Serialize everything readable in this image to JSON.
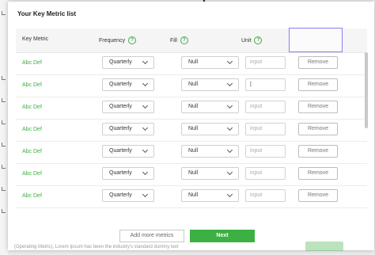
{
  "modal": {
    "title": "Your Key Metric list",
    "columns": {
      "metric": "Key Metric",
      "frequency": "Frequency",
      "fill": "Fill",
      "unit": "Unit",
      "help_glyph": "?"
    },
    "rows": [
      {
        "metric": "Abc Def",
        "frequency": "Quarterly",
        "fill": "Null",
        "unit_placeholder": "input",
        "unit_value": "",
        "remove": "Remove"
      },
      {
        "metric": "Abc Def",
        "frequency": "Quarterly",
        "fill": "Null",
        "unit_placeholder": "",
        "unit_value": "|",
        "remove": "Remove"
      },
      {
        "metric": "Abc Def",
        "frequency": "Quarterly",
        "fill": "Null",
        "unit_placeholder": "input",
        "unit_value": "",
        "remove": "Remove"
      },
      {
        "metric": "Abc Def",
        "frequency": "Quarterly",
        "fill": "Null",
        "unit_placeholder": "input",
        "unit_value": "",
        "remove": "Remove"
      },
      {
        "metric": "Abc Def",
        "frequency": "Quarterly",
        "fill": "Null",
        "unit_placeholder": "input",
        "unit_value": "",
        "remove": "Remove"
      },
      {
        "metric": "Abc Def",
        "frequency": "Quarterly",
        "fill": "Null",
        "unit_placeholder": "input",
        "unit_value": "",
        "remove": "Remove"
      },
      {
        "metric": "Abc Def",
        "frequency": "Quarterly",
        "fill": "Null",
        "unit_placeholder": "input",
        "unit_value": "",
        "remove": "Remove"
      }
    ],
    "buttons": {
      "add_more": "Add more metrics",
      "next": "Next"
    }
  },
  "background": {
    "bottom_text": "(Operating Metric), Lorem Ipsum has been the industry's standard dummy text"
  },
  "colors": {
    "accent_green": "#3cb043",
    "header_highlight": "#8b7cf6"
  }
}
